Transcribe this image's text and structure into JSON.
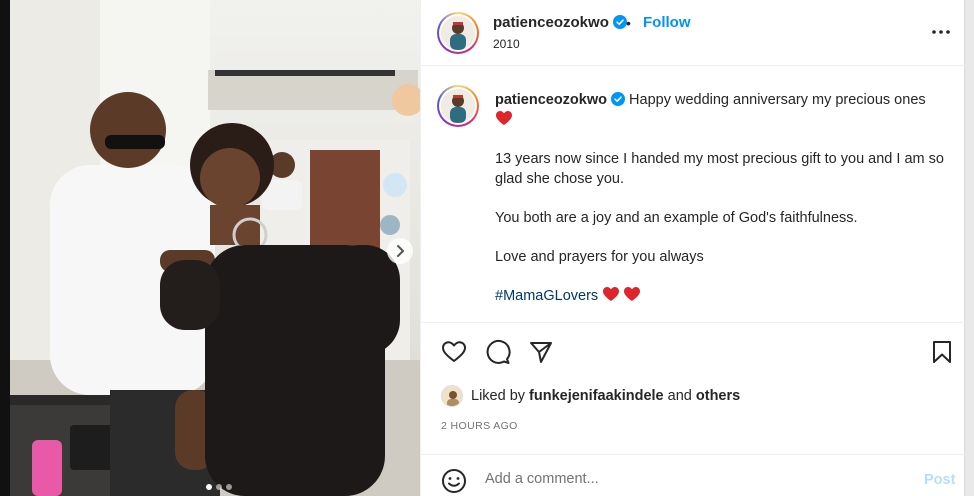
{
  "post": {
    "username": "patienceozokwo",
    "subtitle": "2010",
    "follow_separator": "•",
    "follow_label": "Follow",
    "caption_username": "patienceozokwo",
    "caption_lines": [
      "Happy wedding anniversary my precious ones",
      "13 years now since I handed my most precious gift to you and I am so glad she chose you.",
      "You both are a joy and an example of God's faithfulness.",
      "Love and prayers for you always",
      "#MamaGLovers"
    ],
    "liked_prefix": "Liked by",
    "liked_user": "funkejenifaakindele",
    "liked_joiner": "and",
    "liked_others": "others",
    "timestamp": "2 HOURS AGO",
    "comment_placeholder": "Add a comment...",
    "post_label": "Post"
  },
  "carousel": {
    "slide_count": 3,
    "active_index": 0
  },
  "icons": {
    "more": "more-options-icon",
    "like": "heart-outline-icon",
    "comment": "comment-icon",
    "share": "paper-plane-icon",
    "save": "bookmark-icon",
    "emoji": "emoji-icon",
    "verified": "verified-badge-icon",
    "heart_emoji": "red-heart-emoji-icon",
    "next": "carousel-next-icon"
  },
  "colors": {
    "link_blue": "#0095f6",
    "hashtag": "#00376b",
    "muted": "#737373",
    "post_disabled": "#b2dffc",
    "heart_red": "#e0242b"
  }
}
